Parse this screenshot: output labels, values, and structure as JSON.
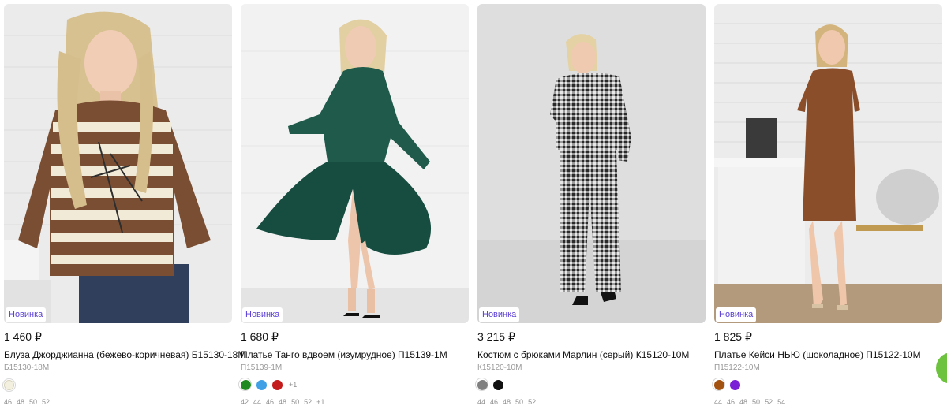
{
  "products": [
    {
      "badge": "Новинка",
      "price": "1 460",
      "currency": "₽",
      "title": "Блуза Джорджианна (бежево-коричневая) Б15130-18М",
      "sku": "Б15130-18М",
      "swatches": [
        "#f3f0df"
      ],
      "swatch_more": "",
      "sizes": [
        "46",
        "48",
        "50",
        "52"
      ]
    },
    {
      "badge": "Новинка",
      "price": "1 680",
      "currency": "₽",
      "title": "Платье Танго вдвоем (изумрудное) П15139-1М",
      "sku": "П15139-1М",
      "swatches": [
        "#1f8a1f",
        "#3fa0e6",
        "#c41c1c"
      ],
      "swatch_more": "+1",
      "sizes": [
        "42",
        "44",
        "46",
        "48",
        "50",
        "52",
        "+1"
      ]
    },
    {
      "badge": "Новинка",
      "price": "3 215",
      "currency": "₽",
      "title": "Костюм с брюками Марлин (серый) К15120-10М",
      "sku": "К15120-10М",
      "swatches": [
        "#808080",
        "#111111"
      ],
      "swatch_more": "",
      "sizes": [
        "44",
        "46",
        "48",
        "50",
        "52"
      ]
    },
    {
      "badge": "Новинка",
      "price": "1 825",
      "currency": "₽",
      "title": "Платье Кейси НЬЮ (шоколадное) П15122-10М",
      "sku": "П15122-10М",
      "swatches": [
        "#a35210",
        "#7b1fd6",
        "#ffffff"
      ],
      "swatch_more": "",
      "sizes": [
        "44",
        "46",
        "48",
        "50",
        "52",
        "54"
      ]
    }
  ]
}
